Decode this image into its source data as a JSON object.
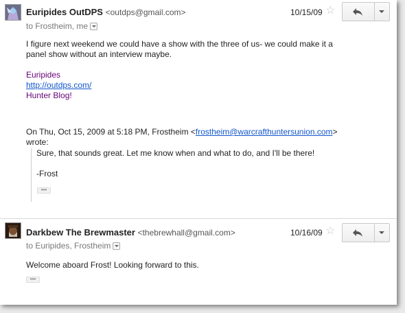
{
  "thread": {
    "messages": [
      {
        "sender_name": "Euripides OutDPS",
        "sender_email": "<outdps@gmail.com>",
        "recipients": "to Frostheim, me",
        "date": "10/15/09",
        "body_line1": "I figure next weekend we could have a show with the three of us- we could make it a",
        "body_line2": "panel show without an interview maybe.",
        "signature_name": "Euripides",
        "signature_link": "http://outdps.com/",
        "signature_blog": "Hunter Blog!",
        "quote_header_prefix": "On Thu, Oct 15, 2009 at 5:18 PM, Frostheim <",
        "quote_header_email": "frostheim@warcrafthuntersunion.com",
        "quote_header_suffix": ">",
        "quote_header_wrote": "wrote:",
        "quote_line1": "Sure, that sounds great. Let me know when and what to do, and I'll be there!",
        "quote_line2": "-Frost",
        "ellipsis": "•••"
      },
      {
        "sender_name": "Darkbew The Brewmaster",
        "sender_email": "<thebrewhall@gmail.com>",
        "recipients": "to Euripides, Frostheim",
        "date": "10/16/09",
        "body": "Welcome aboard Frost!  Looking forward to this.",
        "ellipsis": "•••"
      }
    ]
  },
  "icons": {
    "star": "star-icon",
    "reply": "reply-arrow-icon",
    "more": "dropdown-arrow-icon"
  },
  "colors": {
    "link": "#1155cc",
    "signature": "#660077"
  }
}
